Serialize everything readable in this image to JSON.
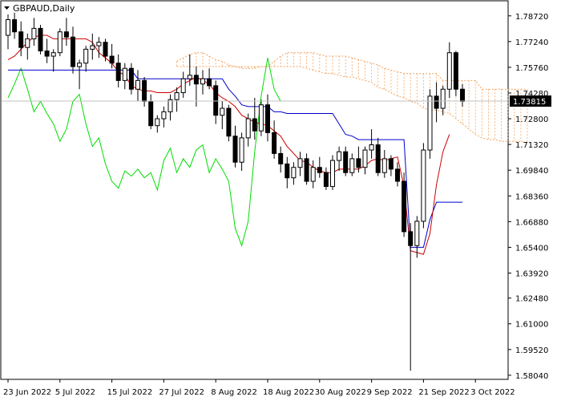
{
  "chart_title": "GBPAUD,Daily",
  "chart_data": {
    "type": "candlestick",
    "title": "GBPAUD,Daily",
    "xlabel": "",
    "ylabel": "",
    "ylim": [
      1.5785,
      1.7954
    ],
    "current_price": 1.73815,
    "current_price_label": "1.73815",
    "y_ticks": [
      "1.78720",
      "1.77240",
      "1.75760",
      "1.74280",
      "1.72800",
      "1.71320",
      "1.69840",
      "1.68360",
      "1.66880",
      "1.65400",
      "1.63920",
      "1.62480",
      "1.61000",
      "1.59520",
      "1.58040"
    ],
    "x_ticks": [
      {
        "label": "23 Jun 2022",
        "index": 0
      },
      {
        "label": "5 Jul 2022",
        "index": 8
      },
      {
        "label": "15 Jul 2022",
        "index": 16
      },
      {
        "label": "27 Jul 2022",
        "index": 24
      },
      {
        "label": "8 Aug 2022",
        "index": 32
      },
      {
        "label": "18 Aug 2022",
        "index": 40
      },
      {
        "label": "30 Aug 2022",
        "index": 48
      },
      {
        "label": "9 Sep 2022",
        "index": 56
      },
      {
        "label": "21 Sep 2022",
        "index": 64
      },
      {
        "label": "3 Oct 2022",
        "index": 72
      }
    ],
    "candles": [
      [
        1.776,
        1.788,
        1.768,
        1.785
      ],
      [
        1.785,
        1.789,
        1.774,
        1.778
      ],
      [
        1.778,
        1.784,
        1.764,
        1.769
      ],
      [
        1.769,
        1.777,
        1.762,
        1.774
      ],
      [
        1.774,
        1.786,
        1.77,
        1.78
      ],
      [
        1.78,
        1.782,
        1.765,
        1.767
      ],
      [
        1.767,
        1.774,
        1.76,
        1.764
      ],
      [
        1.764,
        1.768,
        1.755,
        1.766
      ],
      [
        1.766,
        1.78,
        1.764,
        1.778
      ],
      [
        1.778,
        1.786,
        1.77,
        1.775
      ],
      [
        1.775,
        1.781,
        1.754,
        1.758
      ],
      [
        1.758,
        1.762,
        1.745,
        1.76
      ],
      [
        1.76,
        1.77,
        1.755,
        1.768
      ],
      [
        1.768,
        1.777,
        1.762,
        1.77
      ],
      [
        1.77,
        1.775,
        1.763,
        1.772
      ],
      [
        1.772,
        1.774,
        1.761,
        1.764
      ],
      [
        1.764,
        1.771,
        1.757,
        1.76
      ],
      [
        1.76,
        1.765,
        1.746,
        1.75
      ],
      [
        1.75,
        1.76,
        1.745,
        1.757
      ],
      [
        1.757,
        1.76,
        1.742,
        1.745
      ],
      [
        1.745,
        1.756,
        1.738,
        1.75
      ],
      [
        1.75,
        1.752,
        1.735,
        1.738
      ],
      [
        1.738,
        1.742,
        1.722,
        1.724
      ],
      [
        1.724,
        1.73,
        1.72,
        1.728
      ],
      [
        1.728,
        1.735,
        1.723,
        1.732
      ],
      [
        1.732,
        1.742,
        1.727,
        1.739
      ],
      [
        1.739,
        1.746,
        1.732,
        1.743
      ],
      [
        1.743,
        1.755,
        1.74,
        1.751
      ],
      [
        1.751,
        1.765,
        1.747,
        1.753
      ],
      [
        1.753,
        1.758,
        1.735,
        1.748
      ],
      [
        1.748,
        1.756,
        1.742,
        1.751
      ],
      [
        1.751,
        1.757,
        1.745,
        1.747
      ],
      [
        1.747,
        1.75,
        1.725,
        1.73
      ],
      [
        1.73,
        1.738,
        1.722,
        1.734
      ],
      [
        1.734,
        1.736,
        1.715,
        1.718
      ],
      [
        1.718,
        1.724,
        1.7,
        1.703
      ],
      [
        1.703,
        1.72,
        1.698,
        1.717
      ],
      [
        1.717,
        1.731,
        1.712,
        1.728
      ],
      [
        1.728,
        1.74,
        1.716,
        1.721
      ],
      [
        1.721,
        1.739,
        1.718,
        1.736
      ],
      [
        1.736,
        1.742,
        1.715,
        1.72
      ],
      [
        1.72,
        1.727,
        1.705,
        1.708
      ],
      [
        1.708,
        1.712,
        1.697,
        1.702
      ],
      [
        1.702,
        1.706,
        1.688,
        1.694
      ],
      [
        1.694,
        1.703,
        1.69,
        1.7
      ],
      [
        1.7,
        1.709,
        1.695,
        1.705
      ],
      [
        1.705,
        1.708,
        1.69,
        1.692
      ],
      [
        1.692,
        1.704,
        1.688,
        1.7
      ],
      [
        1.7,
        1.706,
        1.694,
        1.697
      ],
      [
        1.697,
        1.7,
        1.687,
        1.689
      ],
      [
        1.689,
        1.707,
        1.687,
        1.704
      ],
      [
        1.704,
        1.712,
        1.698,
        1.709
      ],
      [
        1.709,
        1.712,
        1.695,
        1.697
      ],
      [
        1.697,
        1.708,
        1.695,
        1.705
      ],
      [
        1.705,
        1.712,
        1.697,
        1.7
      ],
      [
        1.7,
        1.712,
        1.696,
        1.71
      ],
      [
        1.71,
        1.722,
        1.705,
        1.713
      ],
      [
        1.713,
        1.717,
        1.695,
        1.697
      ],
      [
        1.697,
        1.71,
        1.694,
        1.705
      ],
      [
        1.705,
        1.707,
        1.695,
        1.699
      ],
      [
        1.699,
        1.703,
        1.689,
        1.692
      ],
      [
        1.692,
        1.697,
        1.66,
        1.663
      ],
      [
        1.663,
        1.668,
        1.583,
        1.655
      ],
      [
        1.655,
        1.672,
        1.648,
        1.669
      ],
      [
        1.669,
        1.714,
        1.665,
        1.71
      ],
      [
        1.71,
        1.745,
        1.705,
        1.741
      ],
      [
        1.741,
        1.749,
        1.726,
        1.734
      ],
      [
        1.734,
        1.747,
        1.73,
        1.745
      ],
      [
        1.745,
        1.772,
        1.74,
        1.766
      ],
      [
        1.766,
        1.767,
        1.741,
        1.745
      ],
      [
        1.745,
        1.748,
        1.735,
        1.738
      ]
    ],
    "kijun_sen": [
      1.756,
      1.756,
      1.756,
      1.756,
      1.756,
      1.756,
      1.756,
      1.756,
      1.756,
      1.756,
      1.756,
      1.756,
      1.756,
      1.756,
      1.756,
      1.756,
      1.756,
      1.756,
      1.756,
      1.756,
      1.751,
      1.751,
      1.751,
      1.751,
      1.751,
      1.751,
      1.751,
      1.751,
      1.751,
      1.751,
      1.751,
      1.751,
      1.751,
      1.751,
      1.745,
      1.741,
      1.736,
      1.735,
      1.735,
      1.735,
      1.735,
      1.732,
      1.732,
      1.731,
      1.731,
      1.731,
      1.731,
      1.731,
      1.731,
      1.731,
      1.731,
      1.725,
      1.719,
      1.718,
      1.716,
      1.716,
      1.716,
      1.716,
      1.716,
      1.716,
      1.716,
      1.716,
      1.654,
      1.654,
      1.654,
      1.67,
      1.68,
      1.68,
      1.68,
      1.68,
      1.68
    ],
    "tenkan_sen": [
      1.762,
      1.764,
      1.768,
      1.772,
      1.775,
      1.776,
      1.776,
      1.774,
      1.774,
      1.774,
      1.774,
      1.774,
      1.774,
      1.772,
      1.766,
      1.763,
      1.76,
      1.755,
      1.753,
      1.747,
      1.745,
      1.744,
      1.744,
      1.743,
      1.743,
      1.743,
      1.745,
      1.748,
      1.75,
      1.752,
      1.75,
      1.748,
      1.743,
      1.74,
      1.738,
      1.735,
      1.73,
      1.728,
      1.726,
      1.725,
      1.724,
      1.721,
      1.718,
      1.712,
      1.708,
      1.704,
      1.703,
      1.7,
      1.698,
      1.697,
      1.697,
      1.699,
      1.699,
      1.699,
      1.699,
      1.701,
      1.704,
      1.705,
      1.704,
      1.705,
      1.706,
      1.689,
      1.652,
      1.651,
      1.65,
      1.662,
      1.69,
      1.709,
      1.719
    ],
    "chikou_span": [
      1.74,
      1.748,
      1.757,
      1.745,
      1.732,
      1.738,
      1.731,
      1.725,
      1.715,
      1.722,
      1.738,
      1.742,
      1.725,
      1.712,
      1.717,
      1.702,
      1.692,
      1.688,
      1.698,
      1.695,
      1.699,
      1.694,
      1.697,
      1.687,
      1.704,
      1.711,
      1.697,
      1.705,
      1.7,
      1.71,
      1.713,
      1.697,
      1.705,
      1.699,
      1.692,
      1.665,
      1.655,
      1.669,
      1.709,
      1.741,
      1.763,
      1.745,
      1.738
    ],
    "senkou_span_a": [
      1.761,
      1.763,
      1.765,
      1.766,
      1.766,
      1.764,
      1.762,
      1.761,
      1.759,
      1.758,
      1.757,
      1.757,
      1.757,
      1.758,
      1.758,
      1.758,
      1.758,
      1.758,
      1.758,
      1.758,
      1.757,
      1.756,
      1.755,
      1.754,
      1.754,
      1.753,
      1.752,
      1.752,
      1.751,
      1.75,
      1.749,
      1.746,
      1.745,
      1.743,
      1.741,
      1.74,
      1.738,
      1.737,
      1.734,
      1.733,
      1.733,
      1.732,
      1.731,
      1.728,
      1.725,
      1.722,
      1.719,
      1.717,
      1.716,
      1.716,
      1.715,
      1.715,
      1.715,
      1.715,
      1.714
    ],
    "senkou_span_b": [
      1.758,
      1.758,
      1.758,
      1.758,
      1.758,
      1.758,
      1.758,
      1.758,
      1.758,
      1.758,
      1.758,
      1.758,
      1.758,
      1.758,
      1.758,
      1.761,
      1.764,
      1.766,
      1.766,
      1.766,
      1.766,
      1.766,
      1.765,
      1.764,
      1.764,
      1.764,
      1.764,
      1.763,
      1.762,
      1.761,
      1.76,
      1.759,
      1.757,
      1.756,
      1.755,
      1.754,
      1.754,
      1.754,
      1.754,
      1.754,
      1.754,
      1.75,
      1.75,
      1.75,
      1.75,
      1.75,
      1.75,
      1.745,
      1.745,
      1.745,
      1.745,
      1.745,
      1.745,
      1.745,
      1.745
    ],
    "colors": {
      "candle": "#000000",
      "kijun_sen": "#0000cc",
      "tenkan_sen": "#cc0000",
      "chikou_span": "#00dd00",
      "cloud": "#f4a460",
      "price_line": "#c0c0c0",
      "price_box": "#000000"
    },
    "grid": false,
    "legend": "none"
  }
}
